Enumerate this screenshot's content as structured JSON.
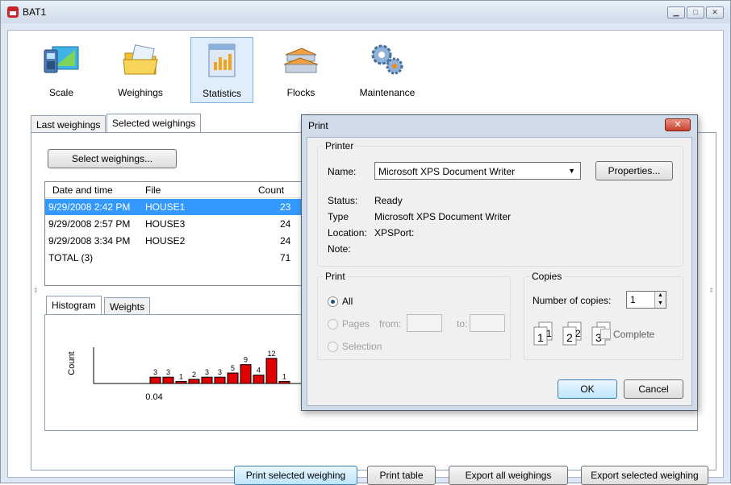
{
  "window": {
    "title": "BAT1"
  },
  "toolbar": [
    {
      "label": "Scale",
      "icon": "scale-icon"
    },
    {
      "label": "Weighings",
      "icon": "weighings-folder-icon"
    },
    {
      "label": "Statistics",
      "icon": "statistics-icon"
    },
    {
      "label": "Flocks",
      "icon": "flocks-barn-icon"
    },
    {
      "label": "Maintenance",
      "icon": "maintenance-gears-icon"
    }
  ],
  "tabs": [
    "Last weighings",
    "Selected weighings"
  ],
  "select_button": "Select weighings...",
  "table": {
    "headers": [
      "Date and time",
      "File",
      "Count"
    ],
    "rows": [
      [
        "9/29/2008 2:42 PM",
        "HOUSE1",
        "23"
      ],
      [
        "9/29/2008 2:57 PM",
        "HOUSE3",
        "24"
      ],
      [
        "9/29/2008 3:34 PM",
        "HOUSE2",
        "24"
      ],
      [
        "TOTAL (3)",
        "",
        "71"
      ]
    ]
  },
  "subtabs": [
    "Histogram",
    "Weights"
  ],
  "chart_data": {
    "type": "bar",
    "ylabel": "Count",
    "xtick": "0.04",
    "values": [
      3,
      3,
      1,
      2,
      3,
      3,
      5,
      9,
      4,
      12,
      1
    ],
    "bar_color": "#e00000"
  },
  "bottom_buttons": [
    "Print selected weighing",
    "Print table",
    "Export all weighings",
    "Export selected weighing"
  ],
  "print_dialog": {
    "title": "Print",
    "printer_group": "Printer",
    "name_label": "Name:",
    "name_value": "Microsoft XPS Document Writer",
    "properties_button": "Properties...",
    "status_label": "Status:",
    "status_value": "Ready",
    "type_label": "Type",
    "type_value": "Microsoft XPS Document Writer",
    "location_label": "Location:",
    "location_value": "XPSPort:",
    "note_label": "Note:",
    "print_group": "Print",
    "all_label": "All",
    "pages_label": "Pages",
    "from_label": "from:",
    "to_label": "to:",
    "selection_label": "Selection",
    "copies_group": "Copies",
    "copies_label": "Number of copies:",
    "copies_value": "1",
    "complete_label": "Complete",
    "ok_button": "OK",
    "cancel_button": "Cancel"
  }
}
